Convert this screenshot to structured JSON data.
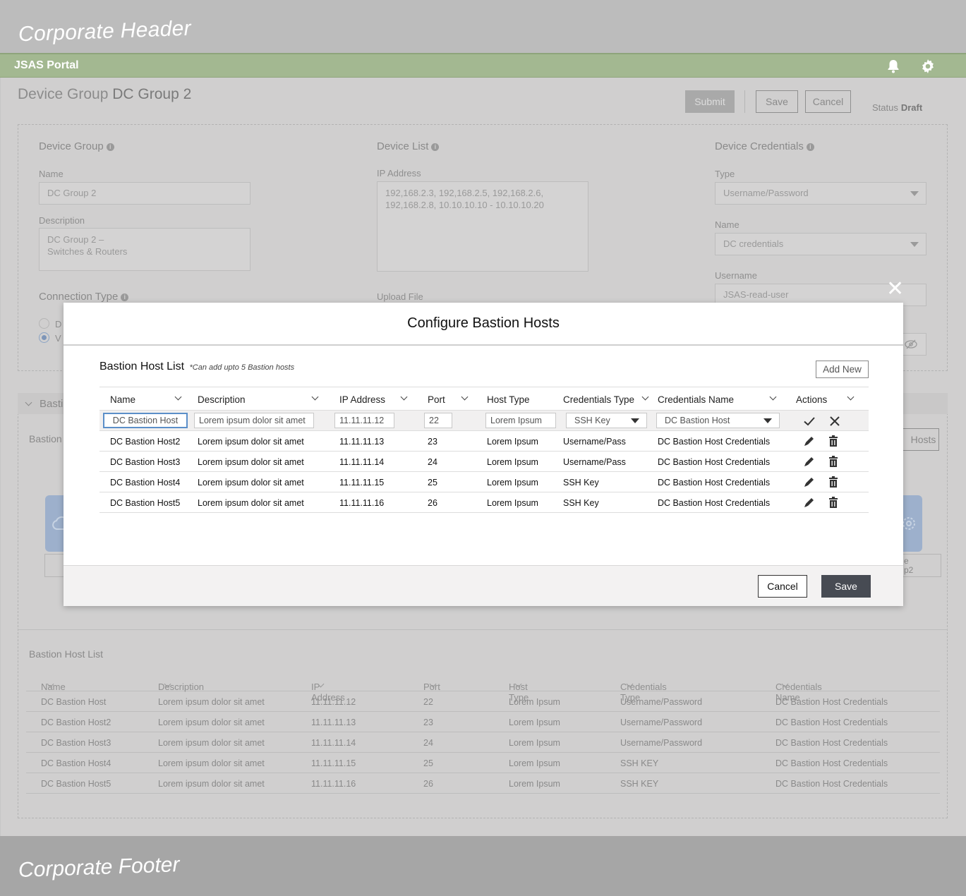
{
  "corporate": {
    "header": "Corporate Header",
    "footer": "Corporate Footer"
  },
  "app": {
    "brand": "JSAS Portal",
    "icons": [
      "bell-icon",
      "gear-icon"
    ]
  },
  "page": {
    "title_prefix": "Device Group",
    "title_name": "DC Group 2",
    "buttons": {
      "submit": "Submit",
      "save": "Save",
      "cancel": "Cancel"
    },
    "status_label": "Status",
    "status_value": "Draft"
  },
  "device_group": {
    "heading": "Device Group",
    "name_label": "Name",
    "name_value": "DC Group 2",
    "description_label": "Description",
    "description_value": "DC Group 2 –\nSwitches & Routers",
    "connection_type_label": "Connection Type",
    "radio_a": "D",
    "radio_b": "V"
  },
  "device_list": {
    "heading": "Device List",
    "ip_label": "IP Address",
    "ip_value": "192,168.2.3, 192,168.2.5, 192,168.2.6,\n192,168.2.8, 10.10.10.10 - 10.10.10.20",
    "upload_label": "Upload File"
  },
  "device_credentials": {
    "heading": "Device Credentials",
    "type_label": "Type",
    "type_value": "Username/Password",
    "name_label": "Name",
    "name_value": "DC credentials",
    "username_label": "Username",
    "username_value": "JSAS-read-user"
  },
  "bastion_section": {
    "collapsed_title": "Basti",
    "side_label": "Bastion",
    "hosts_btn_fragment": "Hosts",
    "card_text_1": "e",
    "card_text_2": "p2"
  },
  "background_table": {
    "title": "Bastion Host List",
    "columns": [
      "Name",
      "Description",
      "IP Address",
      "Port",
      "Host Type",
      "Credentials Type",
      "Credentials Name"
    ],
    "rows": [
      [
        "DC Bastion Host",
        "Lorem ipsum dolor sit amet",
        "11.11.11.12",
        "22",
        "Lorem Ipsum",
        "Username/Password",
        "DC Bastion Host Credentials"
      ],
      [
        "DC Bastion Host2",
        "Lorem ipsum dolor sit amet",
        "11.11.11.13",
        "23",
        "Lorem Ipsum",
        "Username/Password",
        "DC Bastion Host Credentials"
      ],
      [
        "DC Bastion Host3",
        "Lorem ipsum dolor sit amet",
        "11.11.11.14",
        "24",
        "Lorem Ipsum",
        "Username/Password",
        "DC Bastion Host Credentials"
      ],
      [
        "DC Bastion Host4",
        "Lorem ipsum dolor sit amet",
        "11.11.11.15",
        "25",
        "Lorem Ipsum",
        "SSH KEY",
        "DC Bastion Host Credentials"
      ],
      [
        "DC Bastion Host5",
        "Lorem ipsum dolor sit amet",
        "11.11.11.16",
        "26",
        "Lorem Ipsum",
        "SSH KEY",
        "DC Bastion Host Credentials"
      ]
    ]
  },
  "modal": {
    "title": "Configure Bastion Hosts",
    "list_title": "Bastion Host List",
    "list_note": "*Can add upto 5 Bastion hosts",
    "add_new": "Add New",
    "columns": [
      "Name",
      "Description",
      "IP Address",
      "Port",
      "Host Type",
      "Credentials Type",
      "Credentials Name",
      "Actions"
    ],
    "edit_row": {
      "name": "DC Bastion Host",
      "description": "Lorem ipsum dolor sit amet",
      "ip": "11.11.11.12",
      "port": "22",
      "host_type": "Lorem Ipsum",
      "cred_type": "SSH Key",
      "cred_name": "DC Bastion Host"
    },
    "rows": [
      [
        "DC Bastion Host2",
        "Lorem ipsum dolor sit amet",
        "11.11.11.13",
        "23",
        "Lorem Ipsum",
        "Username/Pass",
        "DC Bastion Host Credentials"
      ],
      [
        "DC Bastion Host3",
        "Lorem ipsum dolor sit amet",
        "11.11.11.14",
        "24",
        "Lorem Ipsum",
        "Username/Pass",
        "DC Bastion Host Credentials"
      ],
      [
        "DC Bastion Host4",
        "Lorem ipsum dolor sit amet",
        "11.11.11.15",
        "25",
        "Lorem Ipsum",
        "SSH Key",
        "DC Bastion Host Credentials"
      ],
      [
        "DC Bastion Host5",
        "Lorem ipsum dolor sit amet",
        "11.11.11.16",
        "26",
        "Lorem Ipsum",
        "SSH Key",
        "DC Bastion Host Credentials"
      ]
    ],
    "cancel": "Cancel",
    "save": "Save"
  }
}
